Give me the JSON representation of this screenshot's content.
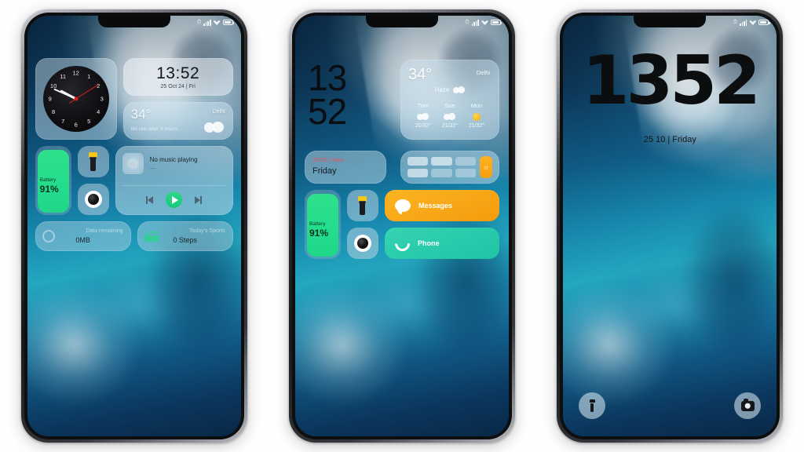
{
  "scene": {
    "background_color": "#ffffff",
    "phone_count": 3,
    "wallpaper_description": "aerial ocean and glacier wallpaper"
  },
  "statusbar": {
    "alarm_icon": "alarm-icon",
    "signal_icon": "signal-bars-icon",
    "wifi_icon": "wifi-icon",
    "battery_icon": "battery-icon"
  },
  "phone1": {
    "clock_widget": {
      "name": "analog-clock",
      "numerals": [
        "1",
        "2",
        "3",
        "4",
        "5",
        "6",
        "7",
        "8",
        "9",
        "10",
        "11",
        "12"
      ],
      "face_color": "#0d0d10",
      "second_hand_color": "#d81f1f"
    },
    "digital_widget": {
      "time": "13:52",
      "date": "25 Oct 24 | Fri"
    },
    "weather_widget": {
      "temperature": "34°",
      "city": "Delhi",
      "summary": "No rain after 8 hours",
      "icon": "cloud-icon"
    },
    "battery_widget": {
      "label": "Battery",
      "value": "91%",
      "fill_color": "#25dd8d"
    },
    "flashlight_tile": {
      "icon": "flashlight-icon"
    },
    "camera_tile": {
      "icon": "camera-lens-icon"
    },
    "music_widget": {
      "title": "No music playing",
      "artist": "—",
      "prev_icon": "skip-previous-icon",
      "play_icon": "play-icon",
      "next_icon": "skip-next-icon",
      "play_color": "#1fc878"
    },
    "data_widget": {
      "title": "Data remaining",
      "value": "0MB",
      "icon": "data-usage-icon"
    },
    "sports_widget": {
      "title": "Today's Sports",
      "value": "0 Steps",
      "icon": "footsteps-icon"
    }
  },
  "phone2": {
    "clock": {
      "hours": "13",
      "minutes": "52"
    },
    "weather_widget": {
      "temperature": "34°",
      "city": "Delhi",
      "condition": "Haze",
      "forecast": [
        {
          "day": "Tom",
          "icon": "cloud-icon",
          "temps": "20/32°"
        },
        {
          "day": "Sun",
          "icon": "cloud-icon",
          "temps": "21/32°"
        },
        {
          "day": "Mon",
          "icon": "sun-icon",
          "temps": "21/32°"
        }
      ]
    },
    "date_widget": {
      "top": "25/10 | Now",
      "bottom": "Friday",
      "top_color": "#e8565f"
    },
    "toggles_widget": {
      "name": "quick-toggles",
      "slider_color": "#f79e10"
    },
    "battery_widget": {
      "label": "Battery",
      "value": "91%"
    },
    "flashlight_tile": {
      "icon": "flashlight-icon"
    },
    "camera_tile": {
      "icon": "camera-lens-icon"
    },
    "messages_tile": {
      "label": "Messages",
      "icon": "message-bubble-icon",
      "color": "#f59b0c"
    },
    "phone_tile": {
      "label": "Phone",
      "icon": "handset-icon",
      "color": "#1fc3a6"
    }
  },
  "phone3": {
    "clock": "1352",
    "date": "25 10 | Friday",
    "flashlight_shortcut": {
      "icon": "flashlight-icon"
    },
    "camera_shortcut": {
      "icon": "camera-icon"
    }
  }
}
